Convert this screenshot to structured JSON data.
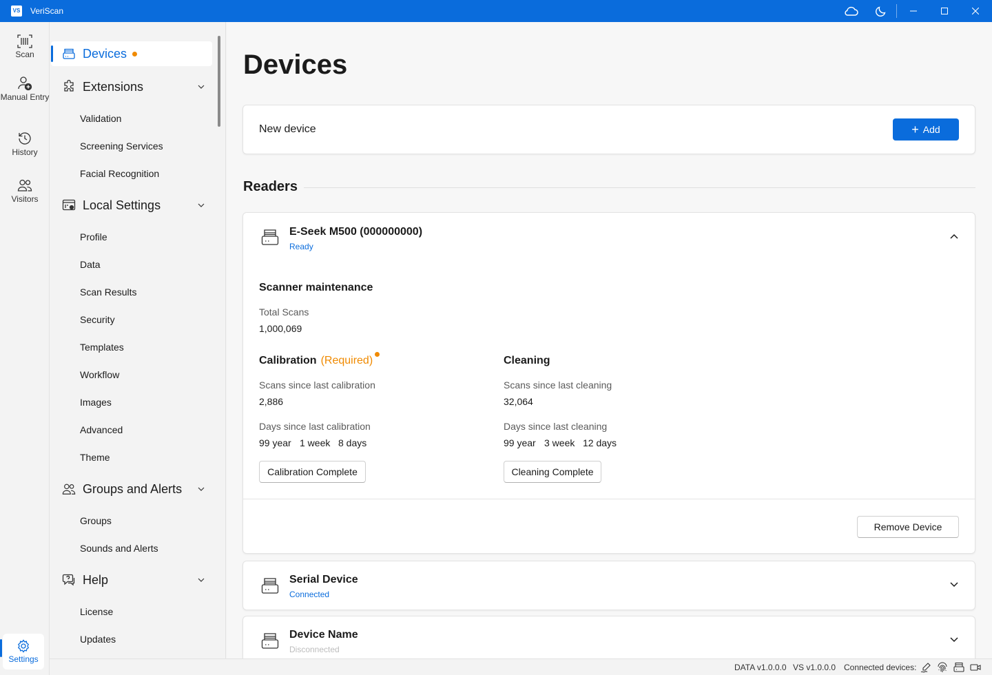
{
  "window": {
    "title": "VeriScan",
    "logo_text": "VS"
  },
  "rail": {
    "items": [
      {
        "label": "Scan",
        "icon": "barcode-scan-icon"
      },
      {
        "label": "Manual Entry",
        "icon": "person-add-icon"
      },
      {
        "label": "History",
        "icon": "history-icon"
      },
      {
        "label": "Visitors",
        "icon": "people-icon"
      },
      {
        "label": "Settings",
        "icon": "gear-icon",
        "active": true
      }
    ]
  },
  "nav": {
    "sections": [
      {
        "label": "Devices",
        "icon": "scanner-icon",
        "active": true,
        "badge_dot": true
      },
      {
        "label": "Extensions",
        "icon": "puzzle-icon",
        "items": [
          "Validation",
          "Screening Services",
          "Facial Recognition"
        ]
      },
      {
        "label": "Local Settings",
        "icon": "local-settings-icon",
        "items": [
          "Profile",
          "Data",
          "Scan Results",
          "Security",
          "Templates",
          "Workflow",
          "Images",
          "Advanced",
          "Theme"
        ]
      },
      {
        "label": "Groups and Alerts",
        "icon": "people-icon",
        "items": [
          "Groups",
          "Sounds and Alerts"
        ]
      },
      {
        "label": "Help",
        "icon": "help-chat-icon",
        "items": [
          "License",
          "Updates"
        ]
      }
    ]
  },
  "main": {
    "title": "Devices",
    "new_device": {
      "label": "New device",
      "add_label": "Add"
    },
    "readers_heading": "Readers",
    "readers": [
      {
        "name": "E-Seek M500 (000000000)",
        "status": "Ready",
        "status_color": "#0a6cdc",
        "expanded": true,
        "maintenance_title": "Scanner maintenance",
        "total_scans_label": "Total Scans",
        "total_scans": "1,000,069",
        "calibration": {
          "title": "Calibration",
          "required": "(Required)",
          "scans_label": "Scans since last calibration",
          "scans": "2,886",
          "days_label": "Days since last calibration",
          "days": [
            "99 year",
            "1 week",
            "8 days"
          ],
          "button": "Calibration Complete"
        },
        "cleaning": {
          "title": "Cleaning",
          "scans_label": "Scans since last cleaning",
          "scans": "32,064",
          "days_label": "Days since last cleaning",
          "days": [
            "99 year",
            "3 week",
            "12 days"
          ],
          "button": "Cleaning Complete"
        },
        "remove_label": "Remove Device"
      },
      {
        "name": "Serial Device",
        "status": "Connected",
        "status_color": "#0a6cdc",
        "expanded": false
      },
      {
        "name": "Device Name",
        "status": "Disconnected",
        "status_color": "#bdbdbd",
        "expanded": false
      }
    ]
  },
  "statusbar": {
    "data_version": "DATA  v1.0.0.0",
    "vs_version": "VS  v1.0.0.0",
    "connected_label": "Connected devices:",
    "device_icons": [
      "signature-pad-icon",
      "fingerprint-icon",
      "scanner-icon",
      "camera-icon"
    ]
  },
  "colors": {
    "accent": "#0a6cdc",
    "warning": "#f08a00"
  }
}
